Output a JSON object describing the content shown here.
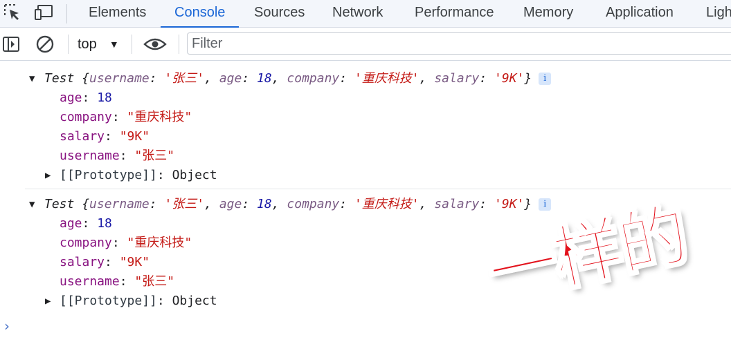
{
  "tabs": [
    {
      "label": "Elements",
      "active": false
    },
    {
      "label": "Console",
      "active": true
    },
    {
      "label": "Sources",
      "active": false
    },
    {
      "label": "Network",
      "active": false
    },
    {
      "label": "Performance",
      "active": false
    },
    {
      "label": "Memory",
      "active": false
    },
    {
      "label": "Application",
      "active": false
    },
    {
      "label": "Ligh",
      "active": false
    }
  ],
  "toolbar": {
    "context": "top",
    "filter_placeholder": "Filter"
  },
  "entries": [
    {
      "class_name": "Test",
      "summary": [
        {
          "key": "username",
          "value": "'张三'",
          "kind": "string"
        },
        {
          "key": "age",
          "value": "18",
          "kind": "number"
        },
        {
          "key": "company",
          "value": "'重庆科技'",
          "kind": "string"
        },
        {
          "key": "salary",
          "value": "'9K'",
          "kind": "string"
        }
      ],
      "properties": [
        {
          "key": "age",
          "value": "18",
          "kind": "number"
        },
        {
          "key": "company",
          "value": "\"重庆科技\"",
          "kind": "string"
        },
        {
          "key": "salary",
          "value": "\"9K\"",
          "kind": "string"
        },
        {
          "key": "username",
          "value": "\"张三\"",
          "kind": "string"
        }
      ],
      "prototype_key": "[[Prototype]]",
      "prototype_value": "Object"
    },
    {
      "class_name": "Test",
      "summary": [
        {
          "key": "username",
          "value": "'张三'",
          "kind": "string"
        },
        {
          "key": "age",
          "value": "18",
          "kind": "number"
        },
        {
          "key": "company",
          "value": "'重庆科技'",
          "kind": "string"
        },
        {
          "key": "salary",
          "value": "'9K'",
          "kind": "string"
        }
      ],
      "properties": [
        {
          "key": "age",
          "value": "18",
          "kind": "number"
        },
        {
          "key": "company",
          "value": "\"重庆科技\"",
          "kind": "string"
        },
        {
          "key": "salary",
          "value": "\"9K\"",
          "kind": "string"
        },
        {
          "key": "username",
          "value": "\"张三\"",
          "kind": "string"
        }
      ],
      "prototype_key": "[[Prototype]]",
      "prototype_value": "Object"
    }
  ],
  "info_glyph": "i",
  "prompt_glyph": "›",
  "sticker_text": "一样的",
  "colors": {
    "accent": "#1a66d6",
    "key": "#881280",
    "string": "#c41a16",
    "number": "#1a1aa6",
    "sticker": "#e3121c"
  }
}
